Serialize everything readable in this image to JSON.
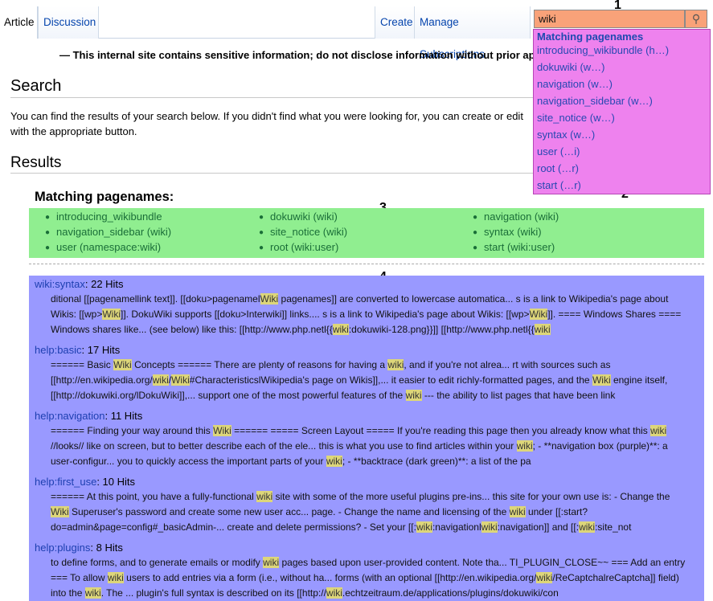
{
  "tabs": {
    "article": "Article",
    "discussion": "Discussion",
    "create": "Create",
    "manage": "Manage Subscriptions"
  },
  "search": {
    "value": "wiki",
    "icon": "search-icon",
    "box_color": "#f9a279"
  },
  "callouts": [
    "1",
    "2",
    "3",
    "4"
  ],
  "dropdown": {
    "heading": "Matching pagenames",
    "items": [
      "introducing_wikibundle (h…)",
      "dokuwiki (w…)",
      "navigation (w…)",
      "navigation_sidebar (w…)",
      "site_notice (w…)",
      "syntax (w…)",
      "user (…i)",
      "root (…r)",
      "start (…r)"
    ],
    "color": "#ee82ee"
  },
  "notice": "— This internal site contains sensitive information; do not disclose information without prior ap",
  "search_heading": "Search",
  "intro": "You can find the results of your search below. If you didn't find what you were looking for, you can create or edit with the appropriate button.",
  "results_heading": "Results",
  "matching_heading": "Matching pagenames:",
  "pagenames": {
    "color": "#90ee90",
    "items": [
      "introducing_wikibundle",
      "dokuwiki (wiki)",
      "navigation (wiki)",
      "navigation_sidebar (wiki)",
      "site_notice (wiki)",
      "syntax (wiki)",
      "user (namespace:wiki)",
      "root (wiki:user)",
      "start (wiki:user)"
    ]
  },
  "hits_color": "#9999ff",
  "hits": [
    {
      "page": "wiki:syntax",
      "count": ": 22 Hits",
      "lines": [
        "ditional [[pagenamellink text]]. [[doku>pagenamel||Wiki|| pagenames]] are converted to lowercase automatica... s is a link to Wikipedia's page about",
        "Wikis: [[wp>||Wiki||]]. DokuWiki supports [[doku>Interwiki]] links.... s is a link to Wikipedia's page about Wikis: [[wp>||Wiki||]]. ==== Windows Shares ====",
        "Windows shares like... (see below) like this: [[http://www.php.netl{{||wiki||:dokuwiki-128.png}}]] [[http://www.php.netl{{||wiki||"
      ]
    },
    {
      "page": "help:basic",
      "count": ": 17 Hits",
      "lines": [
        "====== Basic ||Wiki|| Concepts ====== There are plenty of reasons for having a ||wiki||, and if you're not alrea... rt with sources such as",
        "[[http://en.wikipedia.org/||wiki||/||Wiki||#CharacteristicslWikipedia's page on Wikis]],... it easier to edit richly-formatted pages, and the ||Wiki|| engine itself,",
        "[[http://dokuwiki.org/lDokuWiki]],... support one of the most powerful features of the ||wiki|| --- the ability to list pages that have been link"
      ]
    },
    {
      "page": "help:navigation",
      "count": ": 11 Hits",
      "lines": [
        "====== Finding your way around this ||Wiki|| ====== ===== Screen Layout ===== If you're reading this page then you already know what this ||wiki||",
        "//looks// like on screen, but to better describe each of the ele... this is what you use to find articles within your ||wiki||; - **navigation box (purple)**: a",
        "user-configur... you to quickly access the important parts of your ||wiki||; - **backtrace (dark green)**: a list of the pa"
      ]
    },
    {
      "page": "help:first_use",
      "count": ": 10 Hits",
      "lines": [
        "====== At this point, you have a fully-functional ||wiki|| site with some of the more useful plugins pre-ins... this site for your own use is: - Change the",
        "||Wiki|| Superuser's password and create some new user acc... page. - Change the name and licensing of the ||wiki|| under [[:start?",
        "do=admin&page=config#_basicAdmin-... create and delete permissions? - Set your [[:||wiki||:navigationl||wiki||:navigation]] and [[:||wiki||:site_not"
      ]
    },
    {
      "page": "help:plugins",
      "count": ": 8 Hits",
      "lines": [
        "to define forms, and to generate emails or modify ||wiki|| pages based upon user-provided content. Note tha... TI_PLUGIN_CLOSE~~ === Add an entry",
        "=== To allow ||wiki|| users to add entries via a form (i.e., without ha... forms (with an optional [[http://en.wikipedia.org/||wiki||/ReCaptchalreCaptcha]] field)",
        "into the ||wiki||. The ... plugin's full syntax is described on its [[http://||wiki||.echtzeitraum.de/applications/plugins/dokuwiki/con"
      ]
    }
  ]
}
